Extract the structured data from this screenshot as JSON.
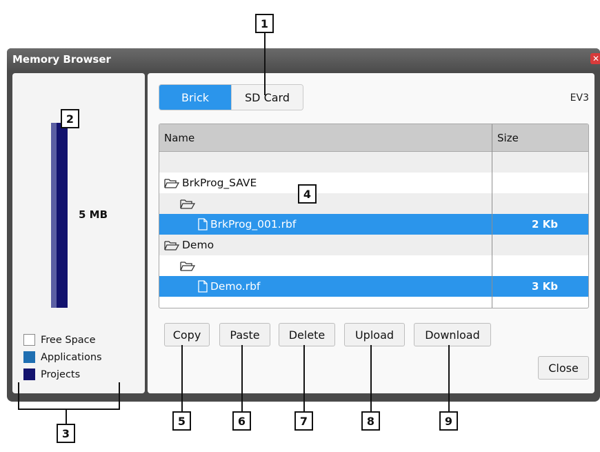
{
  "window": {
    "title": "Memory Browser",
    "close_symbol": "✕"
  },
  "memory": {
    "total_label": "5 MB",
    "legend": [
      {
        "label": "Free Space",
        "color": "#ffffff"
      },
      {
        "label": "Applications",
        "color": "#1f6fb2"
      },
      {
        "label": "Projects",
        "color": "#13136e"
      }
    ]
  },
  "tabs": [
    {
      "label": "Brick",
      "active": true
    },
    {
      "label": "SD Card",
      "active": false
    }
  ],
  "device_label": "EV3",
  "table": {
    "headers": {
      "name": "Name",
      "size": "Size"
    },
    "rows": [
      {
        "name": "",
        "size": "",
        "icon": "",
        "selected": false
      },
      {
        "name": "BrkProg_SAVE",
        "size": "",
        "icon": "folder-icon",
        "selected": false
      },
      {
        "name": "",
        "size": "",
        "icon": "folder-icon",
        "selected": false
      },
      {
        "name": "BrkProg_001.rbf",
        "size": "2 Kb",
        "icon": "file-icon",
        "selected": true
      },
      {
        "name": "Demo",
        "size": "",
        "icon": "folder-icon",
        "selected": false
      },
      {
        "name": "",
        "size": "",
        "icon": "folder-icon",
        "selected": false
      },
      {
        "name": "Demo.rbf",
        "size": "3 Kb",
        "icon": "file-icon",
        "selected": true
      }
    ]
  },
  "buttons": {
    "copy": "Copy",
    "paste": "Paste",
    "delete": "Delete",
    "upload": "Upload",
    "download": "Download",
    "close": "Close"
  },
  "callouts": [
    "1",
    "2",
    "3",
    "4",
    "5",
    "6",
    "7",
    "8",
    "9"
  ]
}
